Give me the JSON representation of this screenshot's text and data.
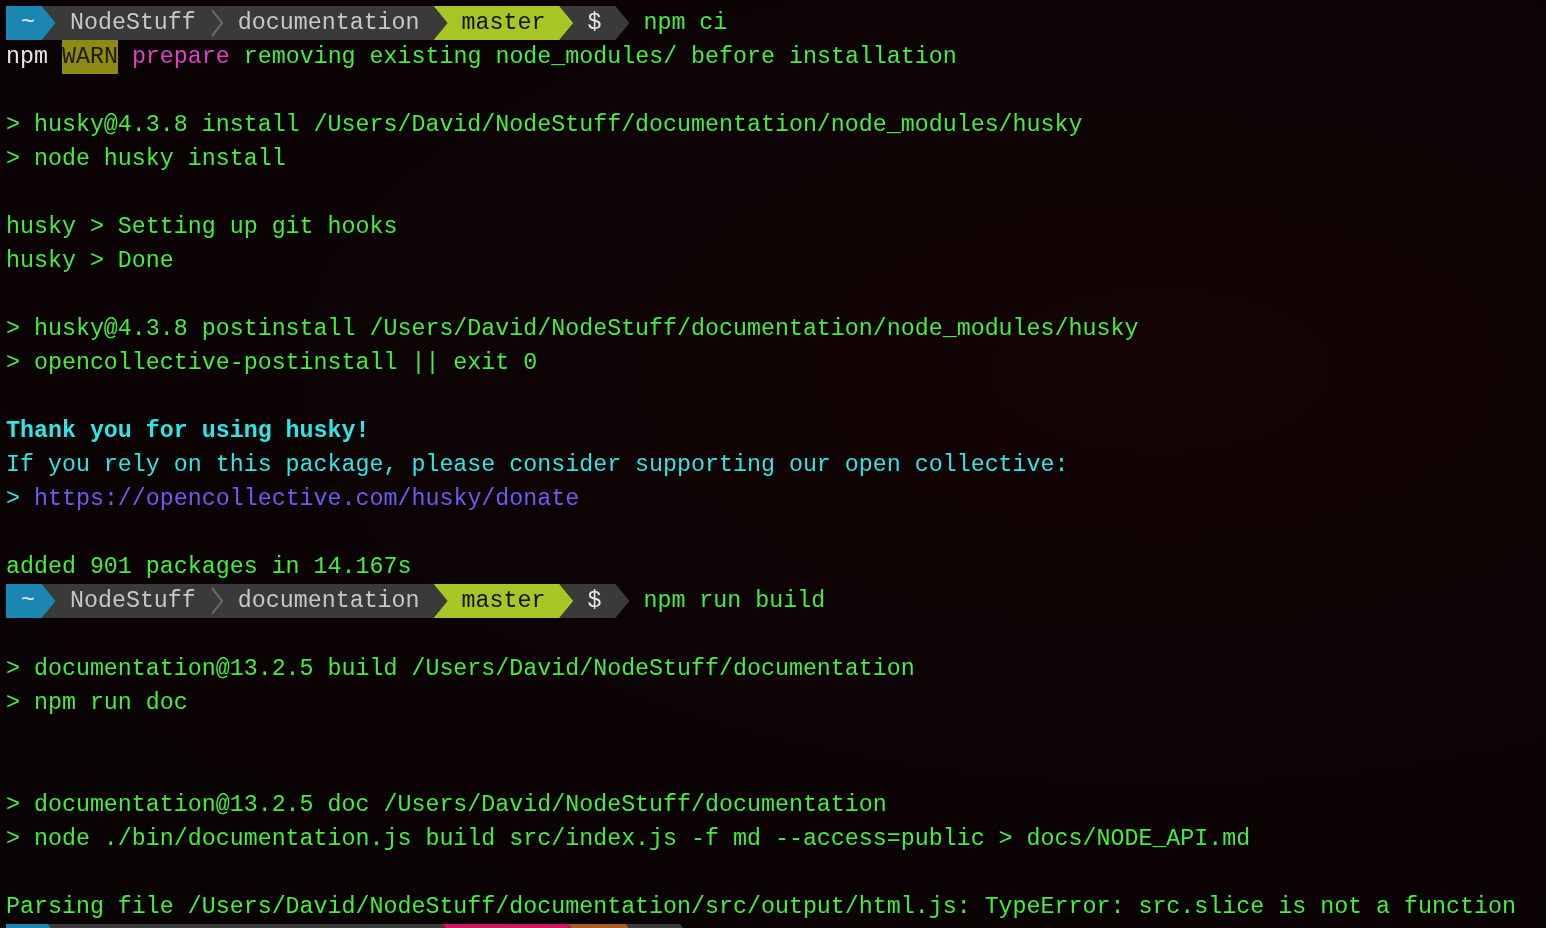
{
  "lines": [
    {
      "kind": "prompt",
      "segments": [
        {
          "kind": "home",
          "texts": [
            "~"
          ],
          "color": "#1b86b1"
        },
        {
          "kind": "path",
          "texts": [
            "NodeStuff",
            "documentation"
          ],
          "color": "#3a3a3a"
        },
        {
          "kind": "branch",
          "texts": [
            "master"
          ],
          "color": "#a5c625"
        },
        {
          "kind": "symbol",
          "texts": [
            "$"
          ],
          "color": "#3a3a3a"
        }
      ],
      "command": "npm ci"
    },
    {
      "kind": "output",
      "spans": [
        {
          "kind": "text",
          "text": "npm",
          "color": "#e6e6e6"
        },
        {
          "kind": "badge",
          "text": "WARN",
          "color": "#8e8a14"
        },
        {
          "kind": "text",
          "text": "prepare",
          "color": "#e040c8"
        },
        {
          "kind": "text",
          "text": "removing existing node_modules/ before installation",
          "color": "#46ee3a"
        }
      ]
    },
    {
      "kind": "blank"
    },
    {
      "kind": "output",
      "spans": [
        {
          "kind": "text",
          "text": "> husky@4.3.8 install /Users/David/NodeStuff/documentation/node_modules/husky",
          "color": "#46ee3a"
        }
      ]
    },
    {
      "kind": "output",
      "spans": [
        {
          "kind": "text",
          "text": "> node husky install",
          "color": "#46ee3a"
        }
      ]
    },
    {
      "kind": "blank"
    },
    {
      "kind": "output",
      "spans": [
        {
          "kind": "text",
          "text": "husky > Setting up git hooks",
          "color": "#46ee3a"
        }
      ]
    },
    {
      "kind": "output",
      "spans": [
        {
          "kind": "text",
          "text": "husky > Done",
          "color": "#46ee3a"
        }
      ]
    },
    {
      "kind": "blank"
    },
    {
      "kind": "output",
      "spans": [
        {
          "kind": "text",
          "text": "> husky@4.3.8 postinstall /Users/David/NodeStuff/documentation/node_modules/husky",
          "color": "#46ee3a"
        }
      ]
    },
    {
      "kind": "output",
      "spans": [
        {
          "kind": "text",
          "text": "> opencollective-postinstall || exit 0",
          "color": "#46ee3a"
        }
      ]
    },
    {
      "kind": "blank"
    },
    {
      "kind": "output",
      "spans": [
        {
          "kind": "bold",
          "text": "Thank you for using husky!",
          "color": "#2ee6e6"
        }
      ]
    },
    {
      "kind": "output",
      "spans": [
        {
          "kind": "text",
          "text": "If you rely on this package, please consider supporting our open collective:",
          "color": "#2ee6e6"
        }
      ]
    },
    {
      "kind": "output",
      "spans": [
        {
          "kind": "text",
          "text": ">",
          "color": "#2ee6e6"
        },
        {
          "kind": "link",
          "text": "https://opencollective.com/husky/donate",
          "color": "#6c5cf5"
        }
      ]
    },
    {
      "kind": "blank"
    },
    {
      "kind": "output",
      "spans": [
        {
          "kind": "text",
          "text": "added 901 packages in 14.167s",
          "color": "#46ee3a"
        }
      ]
    },
    {
      "kind": "prompt",
      "segments": [
        {
          "kind": "home",
          "texts": [
            "~"
          ],
          "color": "#1b86b1"
        },
        {
          "kind": "path",
          "texts": [
            "NodeStuff",
            "documentation"
          ],
          "color": "#3a3a3a"
        },
        {
          "kind": "branch",
          "texts": [
            "master"
          ],
          "color": "#a5c625"
        },
        {
          "kind": "symbol",
          "texts": [
            "$"
          ],
          "color": "#3a3a3a"
        }
      ],
      "command": "npm run build"
    },
    {
      "kind": "blank"
    },
    {
      "kind": "output",
      "spans": [
        {
          "kind": "text",
          "text": "> documentation@13.2.5 build /Users/David/NodeStuff/documentation",
          "color": "#46ee3a"
        }
      ]
    },
    {
      "kind": "output",
      "spans": [
        {
          "kind": "text",
          "text": "> npm run doc",
          "color": "#46ee3a"
        }
      ]
    },
    {
      "kind": "blank"
    },
    {
      "kind": "blank"
    },
    {
      "kind": "output",
      "spans": [
        {
          "kind": "text",
          "text": "> documentation@13.2.5 doc /Users/David/NodeStuff/documentation",
          "color": "#46ee3a"
        }
      ]
    },
    {
      "kind": "output",
      "spans": [
        {
          "kind": "text",
          "text": "> node ./bin/documentation.js build src/index.js -f md --access=public > docs/NODE_API.md",
          "color": "#46ee3a"
        }
      ]
    },
    {
      "kind": "blank"
    },
    {
      "kind": "output",
      "spans": [
        {
          "kind": "text",
          "text": "Parsing file /Users/David/NodeStuff/documentation/src/output/html.js: TypeError: src.slice is not a function",
          "color": "#46ee3a"
        }
      ]
    },
    {
      "kind": "cut_prompt",
      "segments": [
        {
          "color": "#1b86b1"
        },
        {
          "color": "#3a3a3a"
        },
        {
          "color": "#c8175c"
        },
        {
          "color": "#a65f1c"
        },
        {
          "color": "#3a3a3a"
        }
      ]
    }
  ]
}
